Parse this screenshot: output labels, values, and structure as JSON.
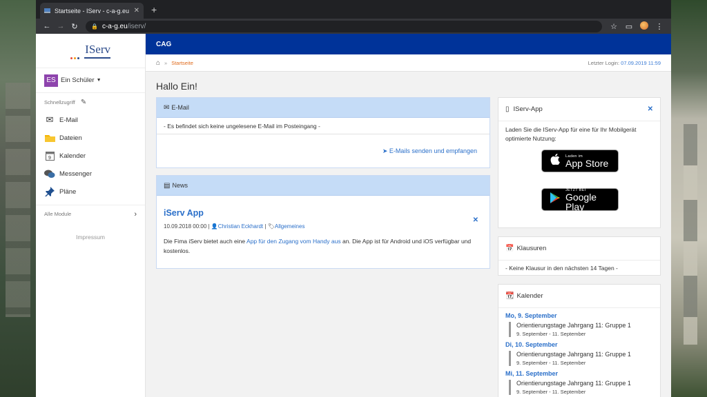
{
  "browser": {
    "tab_title": "Startseite - IServ - c-a-g.eu",
    "url_host": "c-a-g.eu",
    "url_path": "/iserv/"
  },
  "sidebar": {
    "logo_text": "IServ",
    "user_initials": "ES",
    "user_name": "Ein Schüler",
    "quick_access_label": "Schnellzugriff",
    "items": [
      {
        "label": "E-Mail",
        "icon": "envelope-icon"
      },
      {
        "label": "Dateien",
        "icon": "folder-icon"
      },
      {
        "label": "Kalender",
        "icon": "calendar-icon"
      },
      {
        "label": "Messenger",
        "icon": "chat-bubbles-icon"
      },
      {
        "label": "Pläne",
        "icon": "pin-icon"
      }
    ],
    "all_modules_label": "Alle Module",
    "impressum_label": "Impressum"
  },
  "header": {
    "site_name": "CAG",
    "breadcrumb_current": "Startseite",
    "last_login_label": "Letzter Login:",
    "last_login_value": "07.09.2019 11:59"
  },
  "main": {
    "greeting": "Hallo Ein!",
    "email_panel": {
      "title": "E-Mail",
      "message": "- Es befindet sich keine ungelesene E-Mail im Posteingang -",
      "link_label": "E-Mails senden und empfangen"
    },
    "news_panel": {
      "title": "News",
      "article_title": "iServ App",
      "article_date": "10.09.2018 00:00 |",
      "article_author": "Christian Eckhardt",
      "article_sep": "|",
      "article_category": "Allgemeines",
      "body_pre": "Die Fima iServ bietet auch eine",
      "body_link": "App für den Zugang vom Handy aus",
      "body_post": "an. Die App ist für Android und iOS verfügbar und kostenlos."
    }
  },
  "right": {
    "app_panel": {
      "title": "IServ-App",
      "description": "Laden Sie die IServ-App für eine für Ihr Mobilgerät optimierte Nutzung:",
      "appstore_small": "Laden im",
      "appstore_big": "App Store",
      "googleplay_small": "JETZT BEI",
      "googleplay_big": "Google Play"
    },
    "exams_panel": {
      "title": "Klausuren",
      "message": "- Keine Klausur in den nächsten 14 Tagen -"
    },
    "calendar_panel": {
      "title": "Kalender",
      "days": [
        {
          "day": "Mo, 9. September",
          "event": "Orientierungstage Jahrgang 11: Gruppe 1",
          "range": "9. September - 11. September"
        },
        {
          "day": "Di, 10. September",
          "event": "Orientierungstage Jahrgang 11: Gruppe 1",
          "range": "9. September - 11. September"
        },
        {
          "day": "Mi, 11. September",
          "event": "Orientierungstage Jahrgang 11: Gruppe 1",
          "range": "9. September - 11. September"
        }
      ]
    }
  },
  "colors": {
    "brand_blue": "#003399",
    "panel_header": "#c5dcf7",
    "link": "#2a6fc9",
    "breadcrumb_active": "#e06a1b",
    "user_badge": "#8e44ad"
  }
}
